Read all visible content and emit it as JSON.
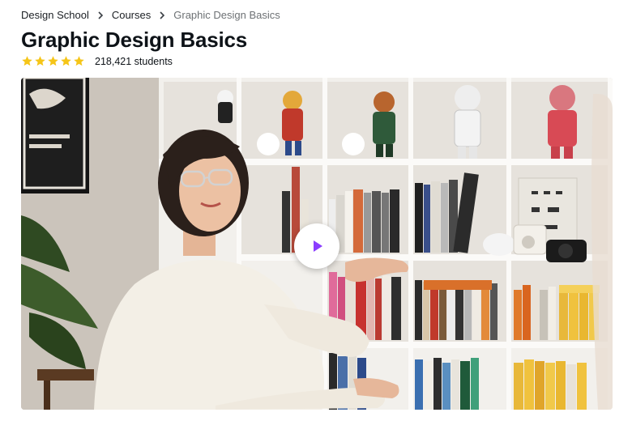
{
  "breadcrumb": {
    "items": [
      "Design School",
      "Courses",
      "Graphic Design Basics"
    ]
  },
  "course": {
    "title": "Graphic Design Basics",
    "rating_stars": 5,
    "students_label": "218,421 students"
  },
  "video": {
    "play_icon": "play-icon",
    "accent_color": "#8b3dff"
  },
  "colors": {
    "star": "#f5c518",
    "text": "#0e1318",
    "muted": "#6d7174"
  }
}
